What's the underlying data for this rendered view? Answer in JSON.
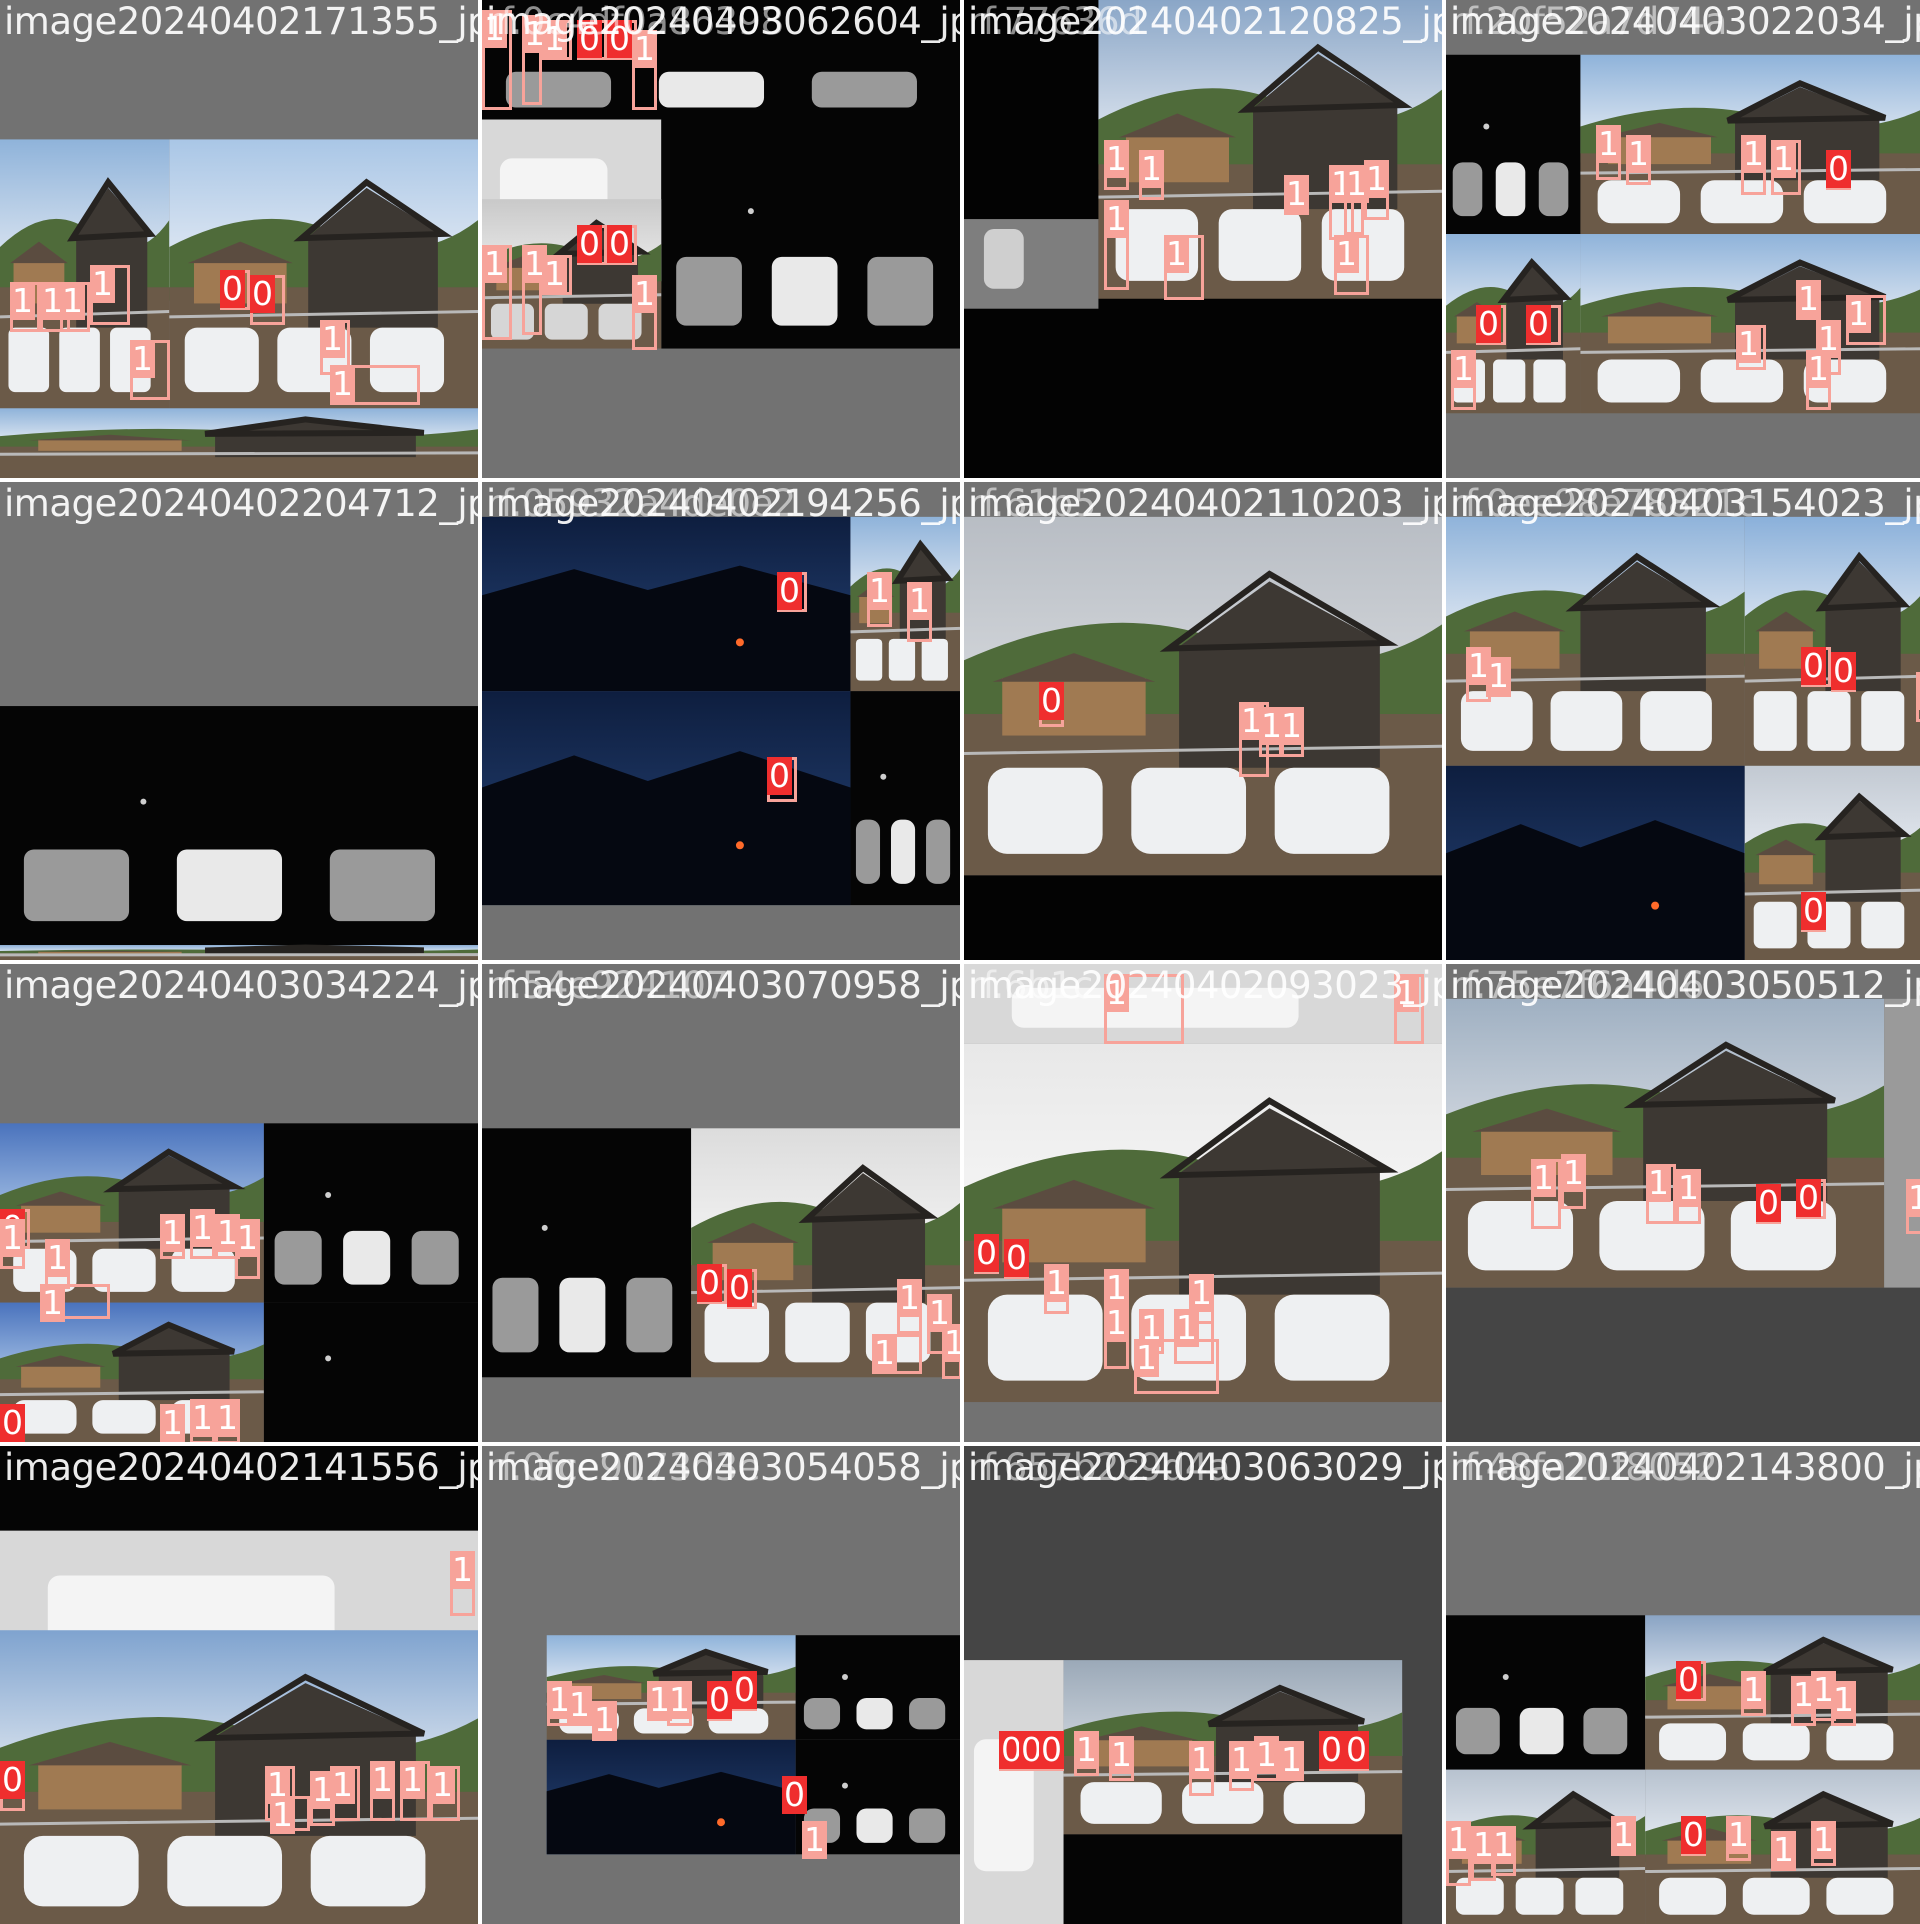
{
  "palette": {
    "box_class0": "#ef2e2e",
    "box_class1": "#f7a39a",
    "pad_gray": "#727272",
    "dark_pad": "#454545",
    "label_text": "#ffffff"
  },
  "tiles": [
    {
      "title": "image20240402171355_jpg.",
      "ghost": "",
      "scene": "day"
    },
    {
      "title": "image20240403062604_jpg.",
      "ghost": "rf.0c4df0a86398",
      "scene": "night-mix"
    },
    {
      "title": "image20240402120825_jpg.",
      "ghost": "rf.77636d",
      "scene": "day-night"
    },
    {
      "title": "image20240403022034_jpg.",
      "ghost": "rf.20f52a7d74a",
      "scene": "mix"
    },
    {
      "title": "image20240402204712_jpg.",
      "ghost": "",
      "scene": "night"
    },
    {
      "title": "image20240402194256_jpg.",
      "ghost": "rf.05932a4de0e2",
      "scene": "dusk"
    },
    {
      "title": "image20240402110203_jpg.",
      "ghost": "rf.61b5",
      "scene": "day"
    },
    {
      "title": "image20240403154023_jpg.",
      "ghost": "rf.0ee98e78821c",
      "scene": "day-mix"
    },
    {
      "title": "image20240403034224_jpg.",
      "ghost": "",
      "scene": "day-night"
    },
    {
      "title": "image20240403070958_jpg.",
      "ghost": "rf.54e924107",
      "scene": "night-day"
    },
    {
      "title": "image20240402093023_jpg.",
      "ghost": "rf.6b1c",
      "scene": "day"
    },
    {
      "title": "image20240403050512_jpg.",
      "ghost": "rf.75e7f6a4d6",
      "scene": "overcast"
    },
    {
      "title": "image20240402141556_jpg.",
      "ghost": "",
      "scene": "night-day"
    },
    {
      "title": "image20240403054058_jpg.",
      "ghost": "rf.0fce9173d3e",
      "scene": "mix-small"
    },
    {
      "title": "image20240403063029_jpg.",
      "ghost": "rf.657b2c9d4a",
      "scene": "overcast-small"
    },
    {
      "title": "image20240402143800_jpg.",
      "ghost": "rf.48fa21f8052",
      "scene": "mix-small"
    }
  ],
  "class_labels": [
    "0",
    "1"
  ]
}
